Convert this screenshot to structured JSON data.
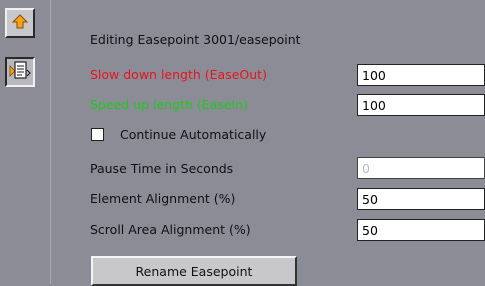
{
  "header": {
    "title": "Editing Easepoint 3001/easepoint"
  },
  "toolbar": {
    "icons": [
      "up-arrow-icon",
      "document-list-icon"
    ]
  },
  "fields": {
    "slow_down": {
      "label": "Slow down length (EaseOut)",
      "value": "100",
      "color": "#e8141e"
    },
    "speed_up": {
      "label": "Speed up length (EaseIn)",
      "value": "100",
      "color": "#1ec81e"
    },
    "continue": {
      "label": "Continue Automatically",
      "checked": false
    },
    "pause": {
      "label": "Pause Time in Seconds",
      "value": "0"
    },
    "element_align": {
      "label": "Element Alignment (%)",
      "value": "50"
    },
    "scroll_align": {
      "label": "Scroll Area Alignment (%)",
      "value": "50"
    }
  },
  "actions": {
    "rename_label": "Rename Easepoint"
  }
}
